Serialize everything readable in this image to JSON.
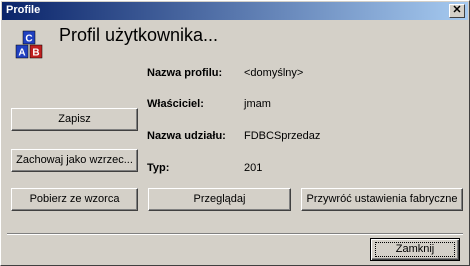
{
  "window": {
    "title": "Profile",
    "close_glyph": "✕"
  },
  "icon": {
    "name": "profile-abc-icon",
    "letters": [
      "C",
      "A",
      "B"
    ],
    "colors": [
      "#2040c0",
      "#2040c0",
      "#c02020"
    ]
  },
  "heading": "Profil użytkownika...",
  "fields": {
    "profile_name": {
      "label": "Nazwa profilu:",
      "value": "<domyślny>"
    },
    "owner": {
      "label": "Właściciel:",
      "value": "jmam"
    },
    "share_name": {
      "label": "Nazwa udziału:",
      "value": "FDBCSprzedaz"
    },
    "type": {
      "label": "Typ:",
      "value": "201"
    }
  },
  "buttons": {
    "save": "Zapisz",
    "save_as_template": "Zachowaj jako wzrzec...",
    "load_from_template": "Pobierz ze wzorca",
    "browse": "Przeglądaj",
    "restore_defaults": "Przywróć ustawienia fabryczne",
    "close": "Zamknij"
  }
}
